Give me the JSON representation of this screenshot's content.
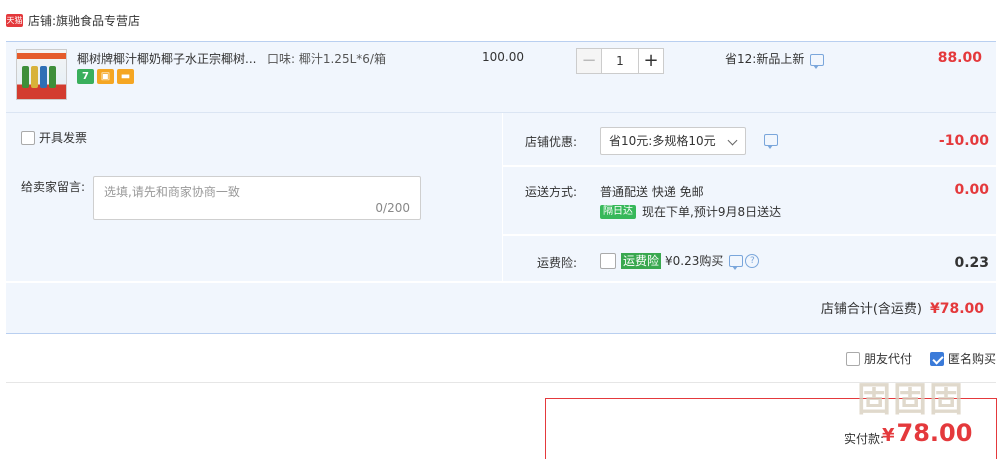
{
  "store": {
    "badge": "天猫",
    "label": "店铺:",
    "name": "旗驰食品专营店"
  },
  "item": {
    "title": "椰树牌椰汁椰奶椰子水正宗椰树...",
    "sku": "口味: 椰汁1.25L*6/箱",
    "unit_price": "100.00",
    "quantity": "1",
    "promo": "省12:新品上新",
    "subtotal": "88.00",
    "badges": [
      {
        "label": "7",
        "color": "#3aaf5c"
      },
      {
        "label": "",
        "color": "#f5a623"
      },
      {
        "label": "",
        "color": "#f5a623"
      }
    ]
  },
  "invoice": {
    "label": "开具发票"
  },
  "message": {
    "label": "给卖家留言:",
    "placeholder": "选填,请先和商家协商一致",
    "counter": "0/200"
  },
  "discount": {
    "label": "店铺优惠:",
    "selected": "省10元:多规格10元",
    "amount": "-10.00"
  },
  "shipping": {
    "label": "运送方式:",
    "method": "普通配送 快递 免邮",
    "badge": "隔日达",
    "eta": "现在下单,预计9月8日送达",
    "amount": "0.00"
  },
  "insurance": {
    "label": "运费险:",
    "tag": "运费险",
    "price": "¥0.23购买",
    "amount": "0.23"
  },
  "store_total": {
    "label": "店铺合计(含运费)",
    "amount": "¥78.00"
  },
  "options": {
    "friend_pay": "朋友代付",
    "anonymous": "匿名购买"
  },
  "payment": {
    "label": "实付款:",
    "currency": "¥",
    "amount": "78.00"
  },
  "watermark": "固固固"
}
